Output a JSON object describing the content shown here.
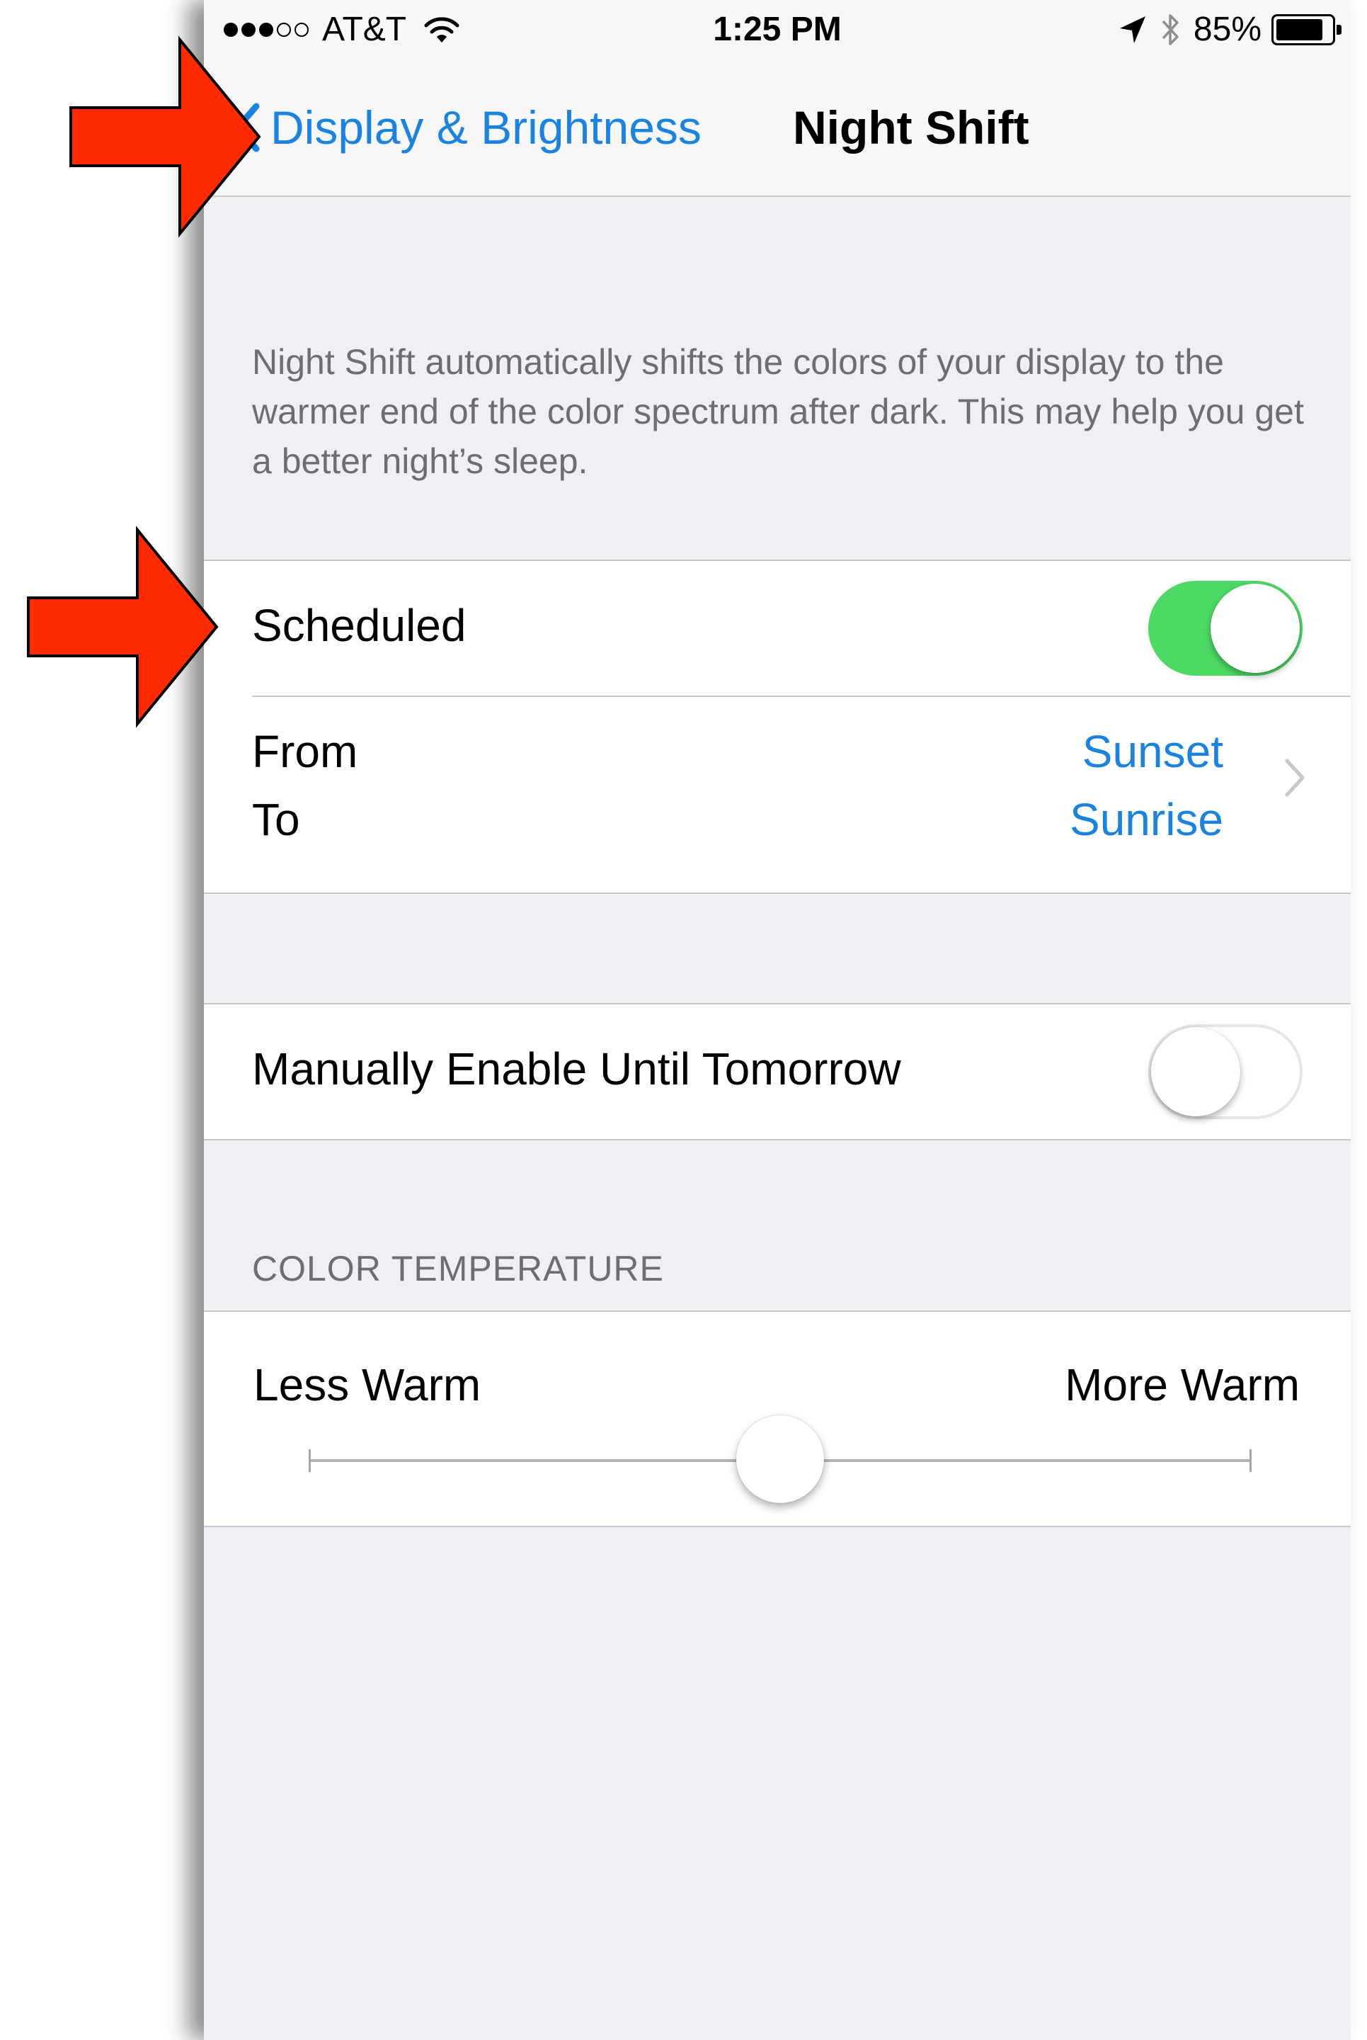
{
  "status_bar": {
    "carrier": "AT&T",
    "signal_bars_filled": 3,
    "signal_bars_total": 5,
    "time": "1:25 PM",
    "battery_percent": "85%",
    "battery_level": 0.85
  },
  "nav": {
    "back_label": "Display & Brightness",
    "title": "Night Shift"
  },
  "description": "Night Shift automatically shifts the colors of your display to the warmer end of the color spectrum after dark. This may help you get a better night’s sleep.",
  "scheduled": {
    "label": "Scheduled",
    "enabled": true
  },
  "schedule_times": {
    "from_label": "From",
    "to_label": "To",
    "from_value": "Sunset",
    "to_value": "Sunrise"
  },
  "manual": {
    "label": "Manually Enable Until Tomorrow",
    "enabled": false
  },
  "color_temperature": {
    "section_header": "COLOR TEMPERATURE",
    "min_label": "Less Warm",
    "max_label": "More Warm",
    "value": 0.5
  },
  "colors": {
    "accent": "#1a82e0",
    "toggle_on": "#4cd964",
    "arrow": "#ff2a00",
    "background": "#efeff4"
  },
  "icons": [
    "wifi-icon",
    "location-icon",
    "bluetooth-icon",
    "battery-icon",
    "chevron-left-icon",
    "chevron-right-icon",
    "arrow-right-icon"
  ]
}
